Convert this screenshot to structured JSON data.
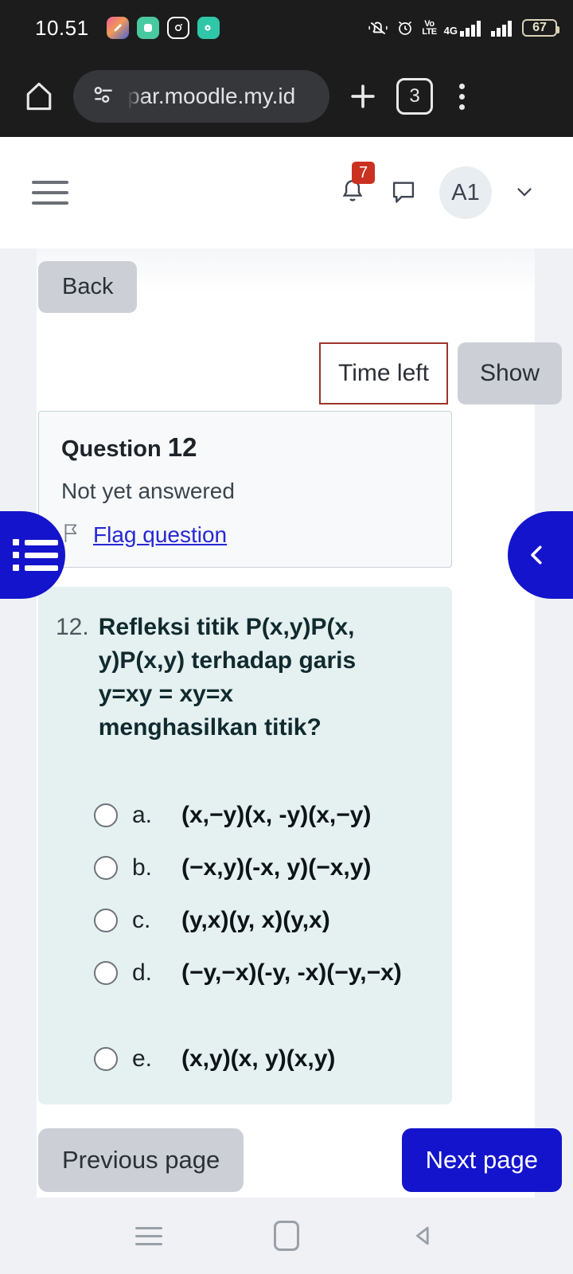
{
  "status_bar": {
    "time": "10.51",
    "battery_percent": "67",
    "network_type": "4G",
    "volte_line1": "Vo",
    "volte_line2": "LTE",
    "icons": [
      "silent-vibrate-icon",
      "alarm-icon",
      "volte-icon",
      "signal-4g-icon",
      "signal-bars-icon",
      "battery-icon"
    ],
    "notification_apps": [
      "app-icon-1",
      "app-icon-2",
      "instagram-icon",
      "app-icon-4"
    ]
  },
  "browser": {
    "url": "par.moodle.my.id",
    "tab_count": "3",
    "home_icon": "home-icon",
    "site_info_icon": "site-settings-icon",
    "new_tab_icon": "plus-icon",
    "menu_icon": "kebab-menu-icon"
  },
  "moodle_header": {
    "menu_icon": "hamburger-icon",
    "notification_badge": "7",
    "avatar_initials": "A1",
    "chevron_icon": "chevron-down-icon"
  },
  "toolbar": {
    "back_label": "Back",
    "time_left_label": "Time left",
    "show_label": "Show"
  },
  "side_buttons": {
    "left_icon": "quiz-navigation-icon",
    "right_icon": "chevron-left-icon"
  },
  "question_info": {
    "title_prefix": "Question",
    "number": "12",
    "status": "Not yet answered",
    "flag_icon": "flag-icon",
    "flag_label": "Flag question"
  },
  "question": {
    "number": "12.",
    "line1": "Refleksi titik P(x,y)P(x,",
    "line2": "y)P(x,y) terhadap garis",
    "line3": "y=xy = xy=x",
    "line4": "menghasilkan titik?",
    "options": [
      {
        "key": "a.",
        "text": "(x,−y)(x, -y)(x,−y)",
        "selected": false
      },
      {
        "key": "b.",
        "text": "(−x,y)(-x, y)(−x,y)",
        "selected": false
      },
      {
        "key": "c.",
        "text": "(y,x)(y, x)(y,x)",
        "selected": false
      },
      {
        "key": "d.",
        "text": "(−y,−x)(-y, -x)(−y,−x)",
        "selected": false
      },
      {
        "key": "e.",
        "text": "(x,y)(x, y)(x,y)",
        "selected": false
      }
    ]
  },
  "pager": {
    "previous_label": "Previous page",
    "next_label": "Next page"
  },
  "android_nav": {
    "recents_icon": "recents-icon",
    "home_icon": "home-square-icon",
    "back_icon": "back-triangle-icon"
  },
  "colors": {
    "accent_blue": "#1414cc",
    "badge_red": "#ca3120",
    "timer_border": "#9c342a",
    "question_card_bg": "#e5f0f1",
    "button_gray": "#ccd0d6",
    "link_blue": "#2727d6"
  }
}
